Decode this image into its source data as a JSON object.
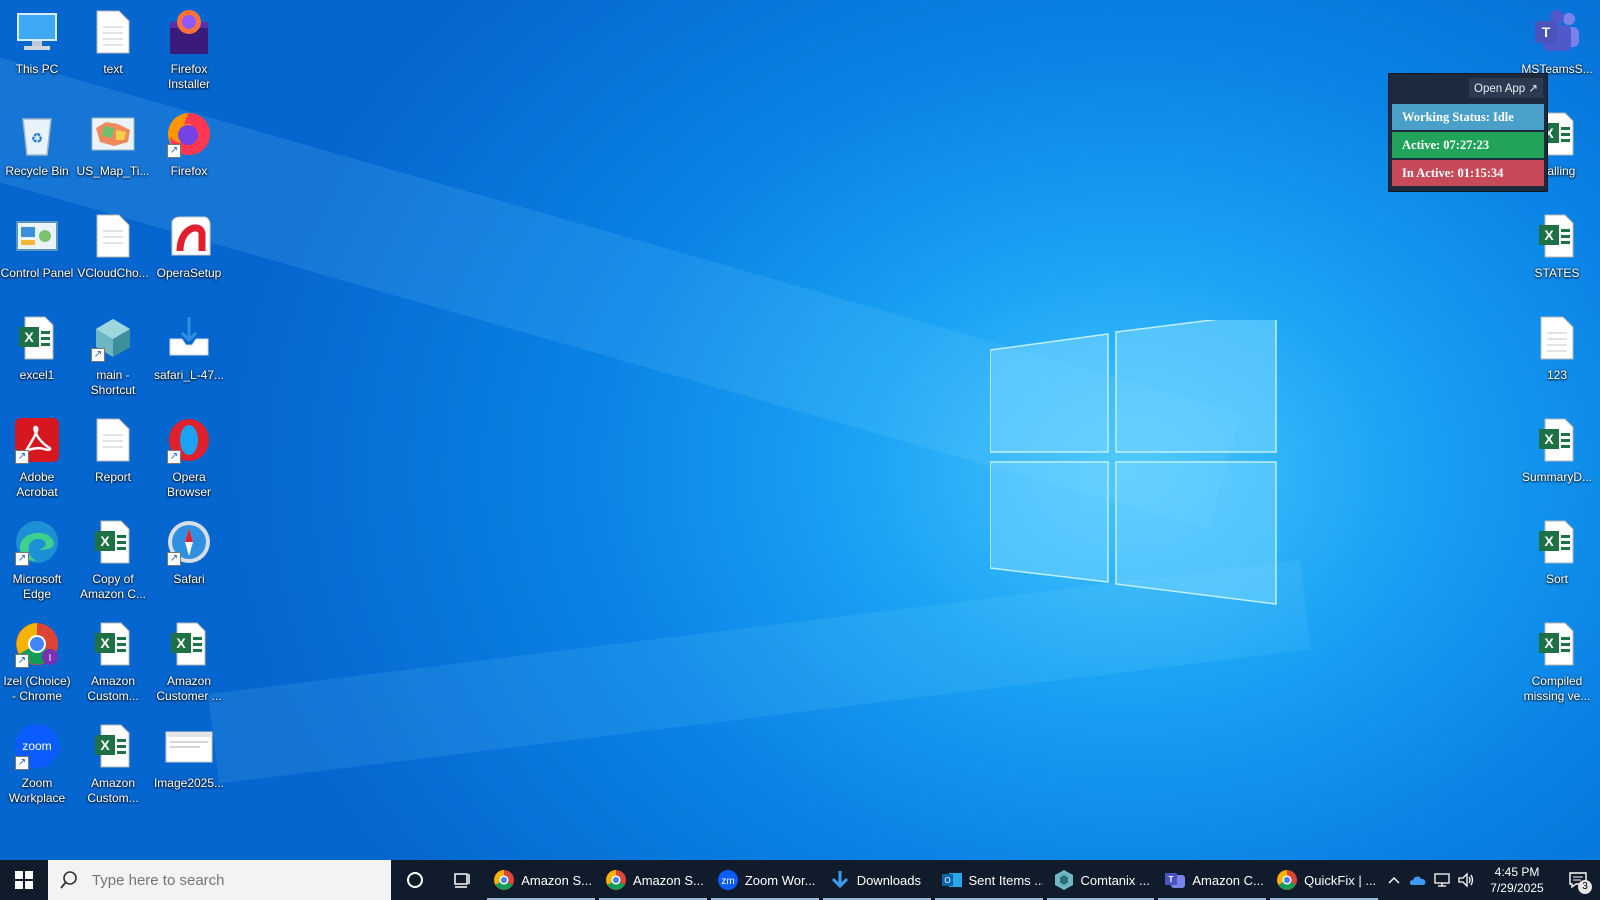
{
  "desktop": {
    "icons": [
      {
        "label": "This PC",
        "icon": "computer-icon"
      },
      {
        "label": "text",
        "icon": "document-icon"
      },
      {
        "label": "Firefox Installer",
        "icon": "firefox-installer-icon"
      },
      {
        "label": "Recycle Bin",
        "icon": "recycle-bin-icon"
      },
      {
        "label": "US_Map_Ti...",
        "icon": "image-file-icon"
      },
      {
        "label": "Firefox",
        "icon": "firefox-icon"
      },
      {
        "label": "Control Panel",
        "icon": "control-panel-icon"
      },
      {
        "label": "VCloudCho...",
        "icon": "document-icon"
      },
      {
        "label": "OperaSetup",
        "icon": "opera-setup-icon"
      },
      {
        "label": "excel1",
        "icon": "excel-icon"
      },
      {
        "label": "main - Shortcut",
        "icon": "app-shortcut-icon"
      },
      {
        "label": "safari_L-47...",
        "icon": "installer-icon"
      },
      {
        "label": "Adobe Acrobat",
        "icon": "acrobat-icon"
      },
      {
        "label": "Report",
        "icon": "document-icon"
      },
      {
        "label": "Opera Browser",
        "icon": "opera-icon"
      },
      {
        "label": "Microsoft Edge",
        "icon": "edge-icon"
      },
      {
        "label": "Copy of Amazon C...",
        "icon": "excel-icon"
      },
      {
        "label": "Safari",
        "icon": "safari-icon"
      },
      {
        "label": "Izel (Choice) - Chrome",
        "icon": "chrome-icon"
      },
      {
        "label": "Amazon Custom...",
        "icon": "excel-icon"
      },
      {
        "label": "Amazon Customer ...",
        "icon": "excel-icon"
      },
      {
        "label": "Zoom Workplace",
        "icon": "zoom-icon"
      },
      {
        "label": "Amazon Custom...",
        "icon": "excel-icon"
      },
      {
        "label": "Image2025...",
        "icon": "image-file-icon"
      },
      {
        "label": "MSTeamsS...",
        "icon": "teams-icon"
      },
      {
        "label": "Calling",
        "icon": "excel-icon"
      },
      {
        "label": "STATES",
        "icon": "excel-icon"
      },
      {
        "label": "123",
        "icon": "document-icon"
      },
      {
        "label": "SummaryD...",
        "icon": "excel-icon"
      },
      {
        "label": "Sort",
        "icon": "excel-icon"
      },
      {
        "label": "Compiled missing ve...",
        "icon": "excel-icon"
      }
    ]
  },
  "widget": {
    "open_app": "Open App ↗",
    "working_status": "Working Status: Idle",
    "active": "Active: 07:27:23",
    "inactive": "In Active: 01:15:34",
    "colors": {
      "status": "#4aa0c9",
      "active": "#21a35b",
      "inactive": "#c64a5a"
    }
  },
  "taskbar": {
    "search_placeholder": "Type here to search",
    "apps": [
      {
        "label": "Amazon S...",
        "icon": "chrome-icon"
      },
      {
        "label": "Amazon S...",
        "icon": "chrome-icon"
      },
      {
        "label": "Zoom Wor...",
        "icon": "zoom-icon"
      },
      {
        "label": "Downloads",
        "icon": "download-icon"
      },
      {
        "label": "Sent Items ...",
        "icon": "outlook-icon"
      },
      {
        "label": "Comtanix ...",
        "icon": "comtanix-icon"
      },
      {
        "label": "Amazon C...",
        "icon": "teams-icon"
      },
      {
        "label": "QuickFix | ...",
        "icon": "chrome-icon"
      }
    ],
    "time": "4:45 PM",
    "date": "7/29/2025",
    "notification_count": "3"
  }
}
